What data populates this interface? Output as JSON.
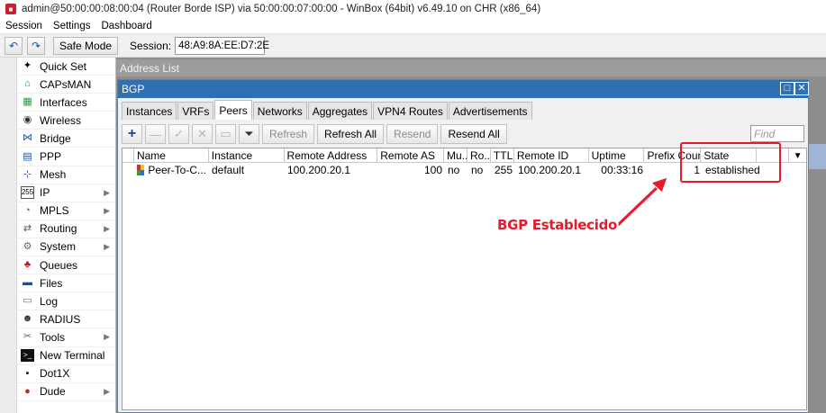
{
  "window": {
    "title": "admin@50:00:00:08:00:04 (Router Borde ISP) via 50:00:00:07:00:00 - WinBox (64bit) v6.49.10 on CHR (x86_64)"
  },
  "menu": [
    "Session",
    "Settings",
    "Dashboard"
  ],
  "toolbar": {
    "undo_icon": "undo-icon",
    "redo_icon": "redo-icon",
    "safe_mode": "Safe Mode",
    "session_label": "Session:",
    "session_value": "48:A9:8A:EE:D7:2E"
  },
  "sidebar": {
    "items": [
      {
        "label": "Quick Set",
        "icon": "quick-set-icon",
        "submenu": false
      },
      {
        "label": "CAPsMAN",
        "icon": "capsman-icon",
        "submenu": false
      },
      {
        "label": "Interfaces",
        "icon": "interfaces-icon",
        "submenu": false
      },
      {
        "label": "Wireless",
        "icon": "wireless-icon",
        "submenu": false
      },
      {
        "label": "Bridge",
        "icon": "bridge-icon",
        "submenu": false
      },
      {
        "label": "PPP",
        "icon": "ppp-icon",
        "submenu": false
      },
      {
        "label": "Mesh",
        "icon": "mesh-icon",
        "submenu": false
      },
      {
        "label": "IP",
        "icon": "ip-icon",
        "submenu": true
      },
      {
        "label": "MPLS",
        "icon": "mpls-icon",
        "submenu": true
      },
      {
        "label": "Routing",
        "icon": "routing-icon",
        "submenu": true
      },
      {
        "label": "System",
        "icon": "system-icon",
        "submenu": true
      },
      {
        "label": "Queues",
        "icon": "queues-icon",
        "submenu": false
      },
      {
        "label": "Files",
        "icon": "files-icon",
        "submenu": false
      },
      {
        "label": "Log",
        "icon": "log-icon",
        "submenu": false
      },
      {
        "label": "RADIUS",
        "icon": "radius-icon",
        "submenu": false
      },
      {
        "label": "Tools",
        "icon": "tools-icon",
        "submenu": true
      },
      {
        "label": "New Terminal",
        "icon": "terminal-icon",
        "submenu": false
      },
      {
        "label": "Dot1X",
        "icon": "dot1x-icon",
        "submenu": false
      },
      {
        "label": "Dude",
        "icon": "dude-icon",
        "submenu": true
      }
    ]
  },
  "background_window": {
    "title": "Address List"
  },
  "bgp": {
    "title": "BGP",
    "tabs": [
      "Instances",
      "VRFs",
      "Peers",
      "Networks",
      "Aggregates",
      "VPN4 Routes",
      "Advertisements"
    ],
    "active_tab": "Peers",
    "buttons": {
      "refresh": "Refresh",
      "refresh_all": "Refresh All",
      "resend": "Resend",
      "resend_all": "Resend All"
    },
    "find_placeholder": "Find",
    "columns": [
      "Name",
      "Instance",
      "Remote Address",
      "Remote AS",
      "Mu...",
      "Ro...",
      "TTL",
      "Remote ID",
      "Uptime",
      "Prefix Count",
      "State"
    ],
    "rows": [
      {
        "name": "Peer-To-C...",
        "instance": "default",
        "remote_address": "100.200.20.1",
        "remote_as": "100",
        "mu": "no",
        "ro": "no",
        "ttl": "255",
        "remote_id": "100.200.20.1",
        "uptime": "00:33:16",
        "prefix_count": "1",
        "state": "established"
      }
    ]
  },
  "annotation": {
    "label": "BGP Establecido",
    "color": "#e8192c"
  },
  "colors": {
    "title_blue": "#2f6fb4",
    "sidebar_strip": "#1b3a8a",
    "annotation_red": "#e8192c"
  }
}
